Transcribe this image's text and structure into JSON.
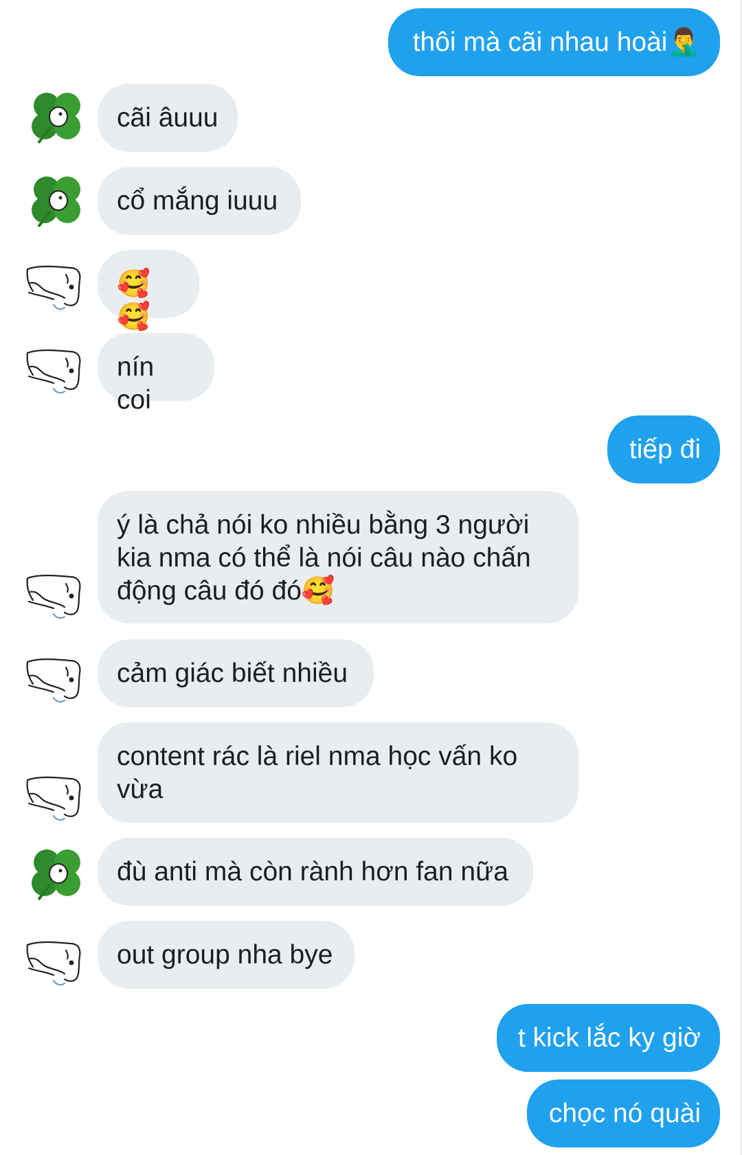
{
  "conversation": {
    "messages": [
      {
        "sender": "me",
        "text": "thôi mà cãi nhau hoài🤦‍♂️"
      },
      {
        "sender": "clover",
        "text": "cãi âuuu"
      },
      {
        "sender": "clover",
        "text": "cổ mắng iuuu"
      },
      {
        "sender": "sketch",
        "text": "🥰🥰"
      },
      {
        "sender": "sketch",
        "text": "nín coi"
      },
      {
        "sender": "me",
        "text": "tiếp đi"
      },
      {
        "sender": "sketch",
        "text": "ý là chả nói ko nhiều bằng 3 người\nkia nma có thể là nói câu nào chấn\nđộng câu đó đó🥰"
      },
      {
        "sender": "sketch",
        "text": "cảm giác biết nhiều"
      },
      {
        "sender": "sketch",
        "text": "content rác là riel nma học vấn ko\nvừa"
      },
      {
        "sender": "clover",
        "text": "đù anti mà còn rành hơn fan nữa"
      },
      {
        "sender": "sketch",
        "text": "out group nha bye"
      },
      {
        "sender": "me",
        "text": "t kick lắc ky giờ"
      },
      {
        "sender": "me",
        "text": "chọc nó quài"
      }
    ]
  },
  "avatars": {
    "clover": "four-leaf-clover-avatar-icon",
    "sketch": "line-sketch-animal-avatar-icon"
  },
  "colors": {
    "outgoing_bubble": "#1fa1ee",
    "incoming_bubble": "#e9edf0",
    "outgoing_text": "#ffffff",
    "incoming_text": "#1c1e21",
    "background": "#ffffff"
  }
}
